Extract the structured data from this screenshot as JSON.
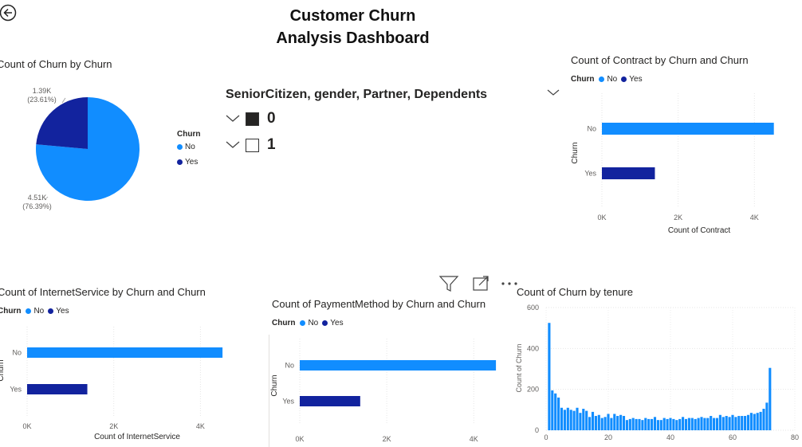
{
  "dashboard": {
    "title_line1": "Customer Churn",
    "title_line2": "Analysis Dashboard"
  },
  "colors": {
    "no": "#118DFF",
    "yes": "#12239E"
  },
  "pie": {
    "title": "Count of Churn by Churn",
    "legend_title": "Churn",
    "legend_items": [
      "No",
      "Yes"
    ],
    "slice_yes_label": "1.39K",
    "slice_yes_pct": "(23.61%)",
    "slice_no_label": "4.51K",
    "slice_no_pct": "(76.39%)"
  },
  "slicer": {
    "title": "SeniorCitizen, gender, Partner, Dependents",
    "items": [
      {
        "label": "0",
        "checked": true
      },
      {
        "label": "1",
        "checked": false
      }
    ]
  },
  "contract": {
    "title": "Count of Contract by Churn and Churn",
    "legend_title": "Churn",
    "legend_items": [
      "No",
      "Yes"
    ],
    "y_label": "Churn",
    "x_label": "Count of Contract",
    "categories": [
      "No",
      "Yes"
    ],
    "ticks": [
      "0K",
      "2K",
      "4K"
    ]
  },
  "internet": {
    "title": "Count of InternetService by Churn and Churn",
    "legend_title": "Churn",
    "legend_items": [
      "No",
      "Yes"
    ],
    "y_label": "Churn",
    "x_label": "Count of InternetService",
    "categories": [
      "No",
      "Yes"
    ],
    "ticks": [
      "0K",
      "2K",
      "4K"
    ]
  },
  "payment": {
    "title": "Count of PaymentMethod by Churn and Churn",
    "legend_title": "Churn",
    "legend_items": [
      "No",
      "Yes"
    ],
    "y_label": "Churn",
    "categories": [
      "No",
      "Yes"
    ],
    "ticks": [
      "0K",
      "2K",
      "4K"
    ]
  },
  "tenure": {
    "title": "Count of Churn by tenure",
    "y_label": "Count of Churn",
    "x_ticks": [
      "0",
      "20",
      "40",
      "60",
      "80"
    ],
    "y_ticks": [
      "0",
      "200",
      "400",
      "600"
    ]
  },
  "chart_data": [
    {
      "type": "pie",
      "title": "Count of Churn by Churn",
      "categories": [
        "No",
        "Yes"
      ],
      "values": [
        4510,
        1390
      ],
      "percent": [
        76.39,
        23.61
      ]
    },
    {
      "type": "bar",
      "title": "Count of Contract by Churn and Churn",
      "orientation": "horizontal",
      "categories": [
        "No",
        "Yes"
      ],
      "values": [
        4510,
        1390
      ],
      "xlim": [
        0,
        4600
      ],
      "xlabel": "Count of Contract",
      "ylabel": "Churn"
    },
    {
      "type": "bar",
      "title": "Count of InternetService by Churn and Churn",
      "orientation": "horizontal",
      "categories": [
        "No",
        "Yes"
      ],
      "values": [
        4510,
        1390
      ],
      "xlim": [
        0,
        4600
      ],
      "xlabel": "Count of InternetService",
      "ylabel": "Churn"
    },
    {
      "type": "bar",
      "title": "Count of PaymentMethod by Churn and Churn",
      "orientation": "horizontal",
      "categories": [
        "No",
        "Yes"
      ],
      "values": [
        4510,
        1390
      ],
      "xlim": [
        0,
        4600
      ],
      "ylabel": "Churn"
    },
    {
      "type": "bar",
      "title": "Count of Churn by tenure",
      "xlabel": "",
      "ylabel": "Count of Churn",
      "xlim": [
        0,
        80
      ],
      "ylim": [
        0,
        600
      ],
      "x": [
        1,
        2,
        3,
        4,
        5,
        6,
        7,
        8,
        9,
        10,
        11,
        12,
        13,
        14,
        15,
        16,
        17,
        18,
        19,
        20,
        21,
        22,
        23,
        24,
        25,
        26,
        27,
        28,
        29,
        30,
        31,
        32,
        33,
        34,
        35,
        36,
        37,
        38,
        39,
        40,
        41,
        42,
        43,
        44,
        45,
        46,
        47,
        48,
        49,
        50,
        51,
        52,
        53,
        54,
        55,
        56,
        57,
        58,
        59,
        60,
        61,
        62,
        63,
        64,
        65,
        66,
        67,
        68,
        69,
        70,
        71,
        72
      ],
      "values": [
        525,
        195,
        180,
        160,
        110,
        100,
        110,
        100,
        95,
        110,
        85,
        105,
        95,
        65,
        90,
        70,
        75,
        60,
        65,
        80,
        60,
        80,
        70,
        75,
        70,
        50,
        55,
        60,
        55,
        55,
        50,
        60,
        55,
        55,
        65,
        50,
        50,
        60,
        55,
        60,
        55,
        50,
        55,
        65,
        55,
        60,
        60,
        55,
        60,
        65,
        60,
        60,
        70,
        60,
        60,
        75,
        65,
        70,
        65,
        75,
        65,
        70,
        70,
        70,
        75,
        85,
        80,
        85,
        90,
        105,
        135,
        305
      ]
    }
  ]
}
